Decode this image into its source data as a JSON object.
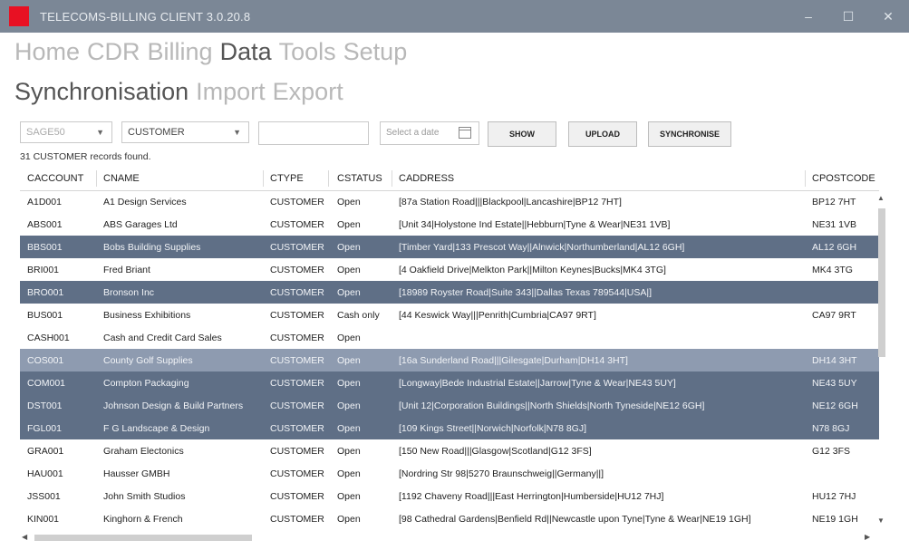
{
  "window": {
    "title": "TELECOMS-BILLING CLIENT 3.0.20.8",
    "controls": {
      "minimize": "–",
      "maximize": "☐",
      "close": "✕"
    }
  },
  "menu": {
    "items": [
      "Home",
      "CDR",
      "Billing",
      "Data",
      "Tools",
      "Setup"
    ],
    "active": "Data"
  },
  "submenu": {
    "items": [
      "Synchronisation",
      "Import",
      "Export"
    ],
    "active": "Synchronisation"
  },
  "toolbar": {
    "source": "SAGE50",
    "entity": "CUSTOMER",
    "search_value": "",
    "date_placeholder": "Select a date",
    "show_label": "SHOW",
    "upload_label": "UPLOAD",
    "sync_label": "SYNCHRONISE"
  },
  "status": {
    "records": "31 CUSTOMER records found."
  },
  "table": {
    "columns": [
      "CACCOUNT",
      "CNAME",
      "CTYPE",
      "CSTATUS",
      "CADDRESS",
      "CPOSTCODE"
    ],
    "rows": [
      {
        "account": "A1D001",
        "name": "A1 Design Services",
        "type": "CUSTOMER",
        "status": "Open",
        "address": "[87a Station Road|||Blackpool|Lancashire|BP12 7HT]",
        "postcode": "BP12 7HT",
        "selected": "none"
      },
      {
        "account": "ABS001",
        "name": "ABS Garages Ltd",
        "type": "CUSTOMER",
        "status": "Open",
        "address": "[Unit 34|Holystone Ind Estate||Hebburn|Tyne & Wear|NE31 1VB]",
        "postcode": "NE31 1VB",
        "selected": "none"
      },
      {
        "account": "BBS001",
        "name": "Bobs Building Supplies",
        "type": "CUSTOMER",
        "status": "Open",
        "address": "[Timber Yard|133 Prescot Way||Alnwick|Northumberland|AL12 6GH]",
        "postcode": "AL12 6GH",
        "selected": "dark"
      },
      {
        "account": "BRI001",
        "name": "Fred Briant",
        "type": "CUSTOMER",
        "status": "Open",
        "address": "[4 Oakfield Drive|Melkton Park||Milton Keynes|Bucks|MK4 3TG]",
        "postcode": "MK4 3TG",
        "selected": "none"
      },
      {
        "account": "BRO001",
        "name": "Bronson Inc",
        "type": "CUSTOMER",
        "status": "Open",
        "address": "[18989 Royster Road|Suite 343||Dallas Texas 789544|USA|]",
        "postcode": "",
        "selected": "dark"
      },
      {
        "account": "BUS001",
        "name": "Business Exhibitions",
        "type": "CUSTOMER",
        "status": "Cash only",
        "address": "[44 Keswick Way|||Penrith|Cumbria|CA97 9RT]",
        "postcode": "CA97 9RT",
        "selected": "none"
      },
      {
        "account": "CASH001",
        "name": "Cash and Credit Card Sales",
        "type": "CUSTOMER",
        "status": "Open",
        "address": "",
        "postcode": "",
        "selected": "none"
      },
      {
        "account": "COS001",
        "name": "County Golf Supplies",
        "type": "CUSTOMER",
        "status": "Open",
        "address": "[16a Sunderland Road|||Gilesgate|Durham|DH14 3HT]",
        "postcode": "DH14 3HT",
        "selected": "light"
      },
      {
        "account": "COM001",
        "name": "Compton Packaging",
        "type": "CUSTOMER",
        "status": "Open",
        "address": "[Longway|Bede Industrial Estate||Jarrow|Tyne & Wear|NE43 5UY]",
        "postcode": "NE43 5UY",
        "selected": "dark"
      },
      {
        "account": "DST001",
        "name": "Johnson Design & Build Partners",
        "type": "CUSTOMER",
        "status": "Open",
        "address": "[Unit 12|Corporation Buildings||North Shields|North Tyneside|NE12 6GH]",
        "postcode": "NE12 6GH",
        "selected": "dark"
      },
      {
        "account": "FGL001",
        "name": "F G Landscape & Design",
        "type": "CUSTOMER",
        "status": "Open",
        "address": "[109 Kings Street||Norwich|Norfolk|N78 8GJ]",
        "postcode": "N78 8GJ",
        "selected": "dark"
      },
      {
        "account": "GRA001",
        "name": "Graham Electonics",
        "type": "CUSTOMER",
        "status": "Open",
        "address": "[150 New Road|||Glasgow|Scotland|G12 3FS]",
        "postcode": "G12 3FS",
        "selected": "none"
      },
      {
        "account": "HAU001",
        "name": "Hausser GMBH",
        "type": "CUSTOMER",
        "status": "Open",
        "address": "[Nordring Str 98|5270 Braunschweig||Germany||]",
        "postcode": "",
        "selected": "none"
      },
      {
        "account": "JSS001",
        "name": "John Smith Studios",
        "type": "CUSTOMER",
        "status": "Open",
        "address": "[1192 Chaveny Road|||East Herrington|Humberside|HU12 7HJ]",
        "postcode": "HU12 7HJ",
        "selected": "none"
      },
      {
        "account": "KIN001",
        "name": "Kinghorn & French",
        "type": "CUSTOMER",
        "status": "Open",
        "address": "[98 Cathedral Gardens|Benfield Rd||Newcastle upon Tyne|Tyne & Wear|NE19 1GH]",
        "postcode": "NE19 1GH",
        "selected": "none"
      }
    ]
  },
  "scroll": {
    "up": "▲",
    "down": "▼",
    "left": "◀",
    "right": "▶"
  }
}
